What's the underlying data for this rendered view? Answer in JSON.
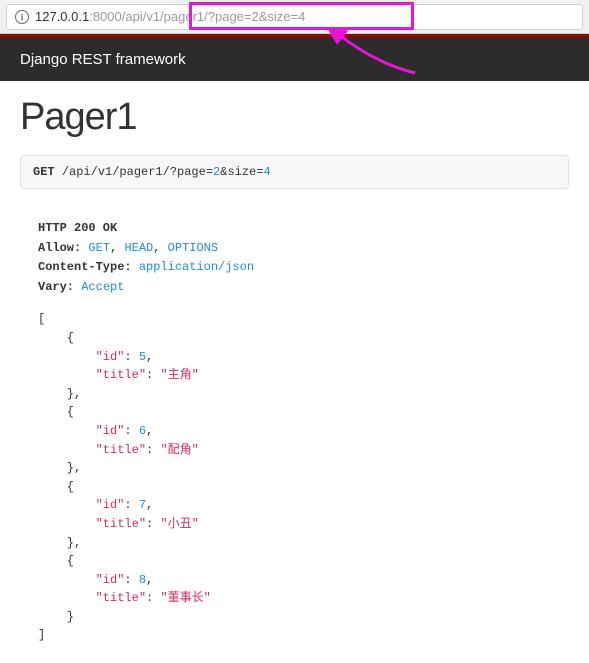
{
  "url": {
    "host": "127.0.0.1",
    "port_path": ":8000/api/v1/pager1/?page=2&size=4"
  },
  "header": {
    "brand": "Django REST framework"
  },
  "page": {
    "title": "Pager1"
  },
  "request": {
    "method": "GET",
    "path_prefix": "/api/v1/pager1/?page=",
    "page": "2",
    "mid": "&size=",
    "size": "4"
  },
  "response": {
    "status": "HTTP 200 OK",
    "headers": [
      {
        "key": "Allow",
        "values": [
          "GET",
          "HEAD",
          "OPTIONS"
        ]
      },
      {
        "key": "Content-Type",
        "values": [
          "application/json"
        ]
      },
      {
        "key": "Vary",
        "values": [
          "Accept"
        ]
      }
    ]
  },
  "chart_data": {
    "type": "table",
    "columns": [
      "id",
      "title"
    ],
    "rows": [
      {
        "id": 5,
        "title": "主角"
      },
      {
        "id": 6,
        "title": "配角"
      },
      {
        "id": 7,
        "title": "小丑"
      },
      {
        "id": 8,
        "title": "董事长"
      }
    ]
  }
}
